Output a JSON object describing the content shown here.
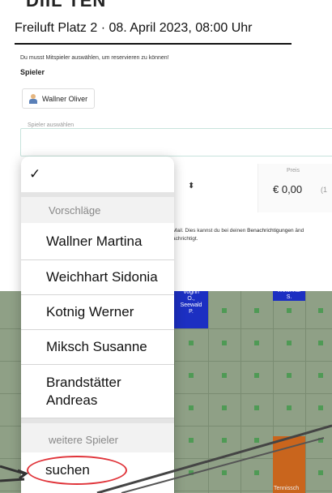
{
  "header_top": "DIIL TEN",
  "modal": {
    "title": "Freiluft Platz 2 · 08. April 2023, 08:00 Uhr",
    "hint": "Du musst Mitspieler auswählen, um reservieren zu können!",
    "players_label": "Spieler",
    "selected_player": "Wallner Oliver",
    "select_label": "Spieler auswählen",
    "price_label": "Preis",
    "price_value": "€ 0,00",
    "price_extra": "(1",
    "mail_line1_pre": "Mail. Dies kannst du bei deinen ",
    "mail_line1_bold": "Benachrichtigungen",
    "mail_line1_post": " änd",
    "mail_line2": "achrichtigt."
  },
  "dropdown": {
    "check": "✓",
    "group_suggestions": "Vorschläge",
    "suggestions": [
      "Wallner Martina",
      "Weichhart Sidonia",
      "Kotnig Werner",
      "Miksch Susanne",
      "Brandstätter Andreas"
    ],
    "group_more": "weitere Spieler",
    "search_label": "suchen"
  },
  "court": {
    "cell_a_lines": [
      "Vogrin",
      "O.,",
      "Seewald",
      "P."
    ],
    "cell_b_lines": [
      "Weichhar",
      "S."
    ],
    "tennis_label": "Tennissch"
  },
  "colors": {
    "annotation_red": "#e0343a",
    "court_blue": "#1c2fc2",
    "court_orange": "#c9651d",
    "court_green": "#8fa086"
  },
  "icons": {
    "check": "checkmark-icon",
    "chevron": "up-down-chevron-icon",
    "avatar": "avatar-icon",
    "close": "close-icon"
  }
}
